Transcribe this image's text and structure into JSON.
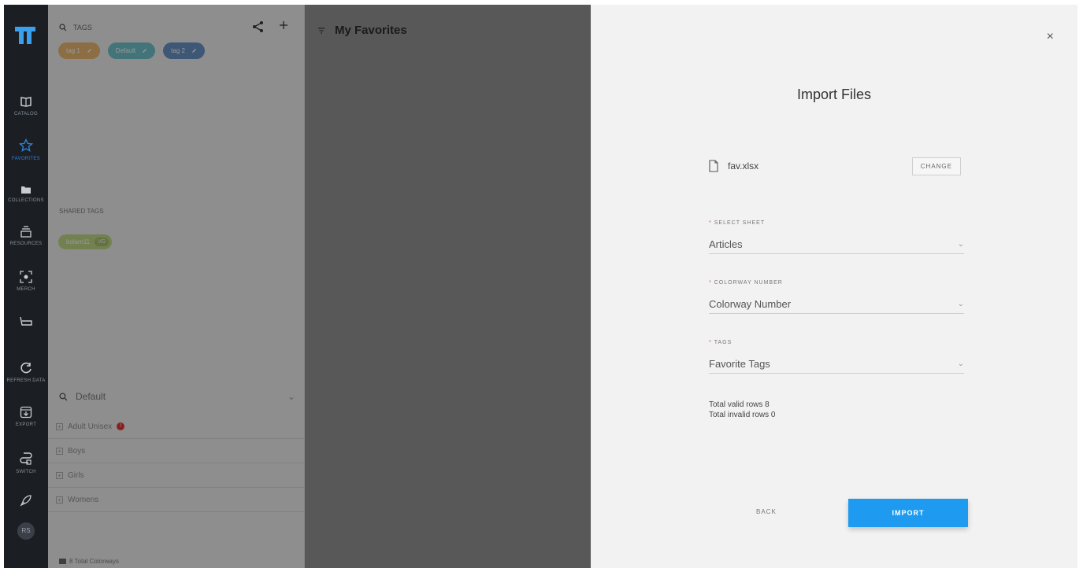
{
  "nav": {
    "items": [
      {
        "label": "CATALOG"
      },
      {
        "label": "FAVORITES"
      },
      {
        "label": "COLLECTIONS"
      },
      {
        "label": "RESOURCES"
      },
      {
        "label": "MERCH"
      },
      {
        "label": ""
      },
      {
        "label": "REFRESH DATA"
      },
      {
        "label": "EXPORT"
      },
      {
        "label": "SWITCH"
      }
    ],
    "avatar": "RS"
  },
  "tags_panel": {
    "search_label": "TAGS",
    "tags": [
      {
        "label": "tag 1",
        "color": "#e0962f"
      },
      {
        "label": "Default",
        "color": "#2aa6b5"
      },
      {
        "label": "tag 2",
        "color": "#1f5fae"
      }
    ],
    "shared_title": "SHARED TAGS",
    "shared_tag": {
      "label": "bolam11",
      "badge": "VG"
    },
    "default_search": "Default",
    "tree": [
      {
        "label": "Adult Unisex",
        "warning": "!"
      },
      {
        "label": "Boys"
      },
      {
        "label": "Girls"
      },
      {
        "label": "Womens"
      }
    ],
    "footer": "8 Total Colorways"
  },
  "favorites": {
    "title": "My Favorites"
  },
  "modal": {
    "close": "×",
    "title": "Import Files",
    "file_name": "fav.xlsx",
    "change_label": "CHANGE",
    "fields": [
      {
        "label": "SELECT SHEET",
        "value": "Articles"
      },
      {
        "label": "COLORWAY NUMBER",
        "value": "Colorway Number"
      },
      {
        "label": "TAGS",
        "value": "Favorite Tags"
      }
    ],
    "totals": {
      "valid": "Total valid rows 8",
      "invalid": "Total invalid rows 0"
    },
    "back_label": "BACK",
    "import_label": "IMPORT"
  }
}
